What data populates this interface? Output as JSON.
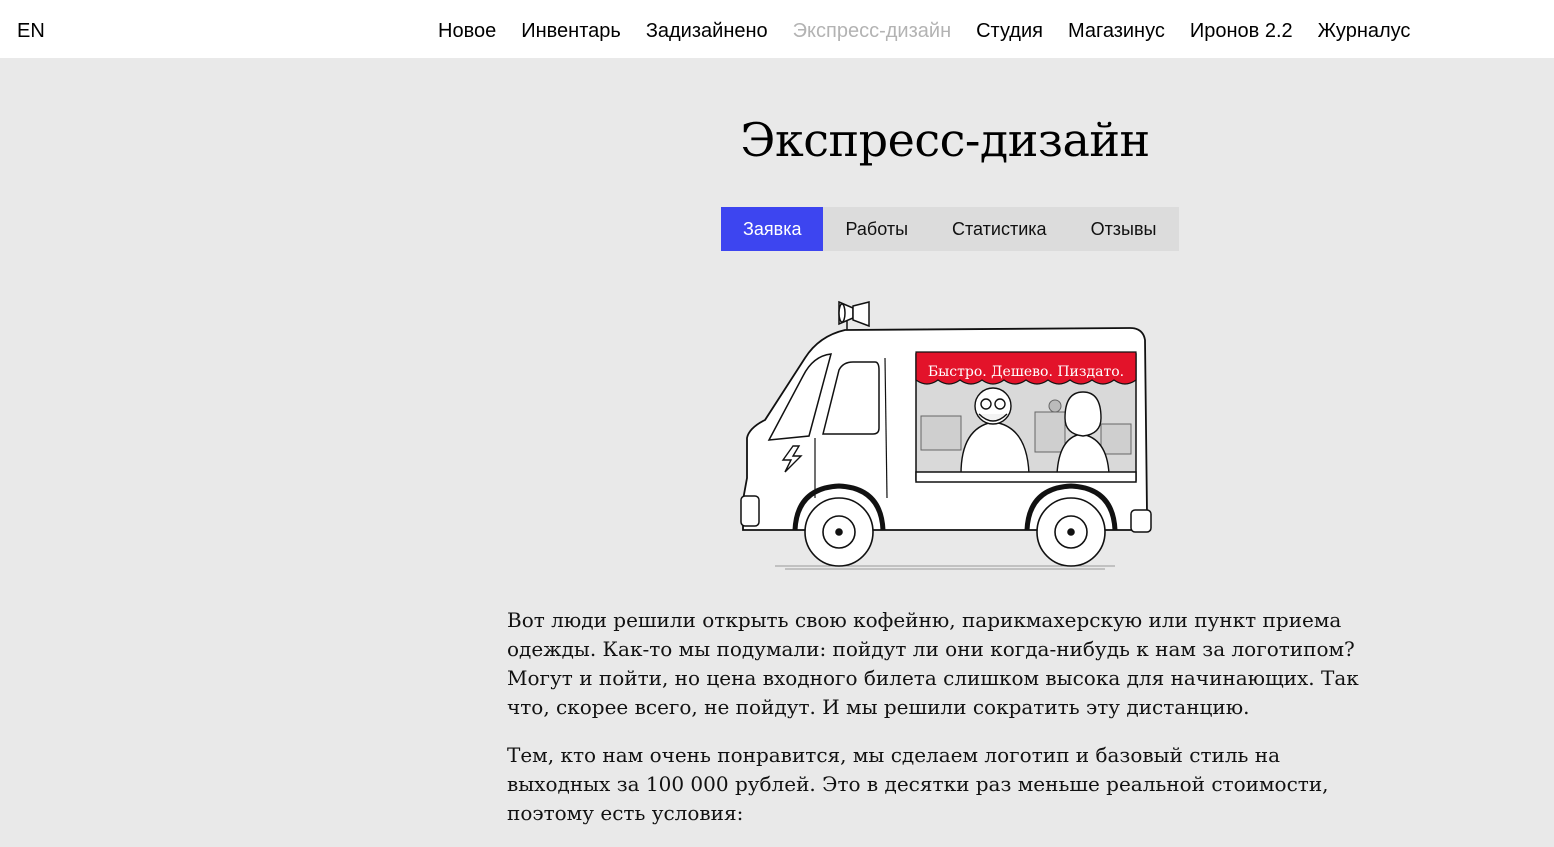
{
  "header": {
    "lang_switch": "EN",
    "nav": [
      {
        "label": "Новое",
        "active": false
      },
      {
        "label": "Инвентарь",
        "active": false
      },
      {
        "label": "Задизайнено",
        "active": false
      },
      {
        "label": "Экспресс-дизайн",
        "active": true
      },
      {
        "label": "Студия",
        "active": false
      },
      {
        "label": "Магазинус",
        "active": false
      },
      {
        "label": "Иронов 2.2",
        "active": false
      },
      {
        "label": "Журналус",
        "active": false
      }
    ]
  },
  "main": {
    "title": "Экспресс-дизайн",
    "tabs": [
      {
        "label": "Заявка",
        "active": true
      },
      {
        "label": "Работы",
        "active": false
      },
      {
        "label": "Статистика",
        "active": false
      },
      {
        "label": "Отзывы",
        "active": false
      }
    ],
    "illustration": {
      "icon": "food-truck-illustration",
      "awning_text": "Быстро. Дешево. Пиздато.",
      "awning_color": "#e3132a"
    },
    "paragraphs": [
      "Вот люди решили открыть свою кофейню, парикмахерскую или пункт приема одежды. Как-то мы подумали: пойдут ли они когда-нибудь к нам за логотипом? Могут и пойти, но цена входного билета слишком высока для начинающих. Так что, скорее всего, не пойдут. И мы решили сократить эту дистанцию.",
      "Тем, кто нам очень понравится, мы сделаем логотип и базовый стиль на выходных за 100 000 рублей. Это в десятки раз меньше реальной стоимости, поэтому есть условия:"
    ]
  },
  "colors": {
    "accent": "#3d45f0",
    "background": "#e9e9e9",
    "header_bg": "#ffffff",
    "nav_active": "#b3b3b3"
  }
}
